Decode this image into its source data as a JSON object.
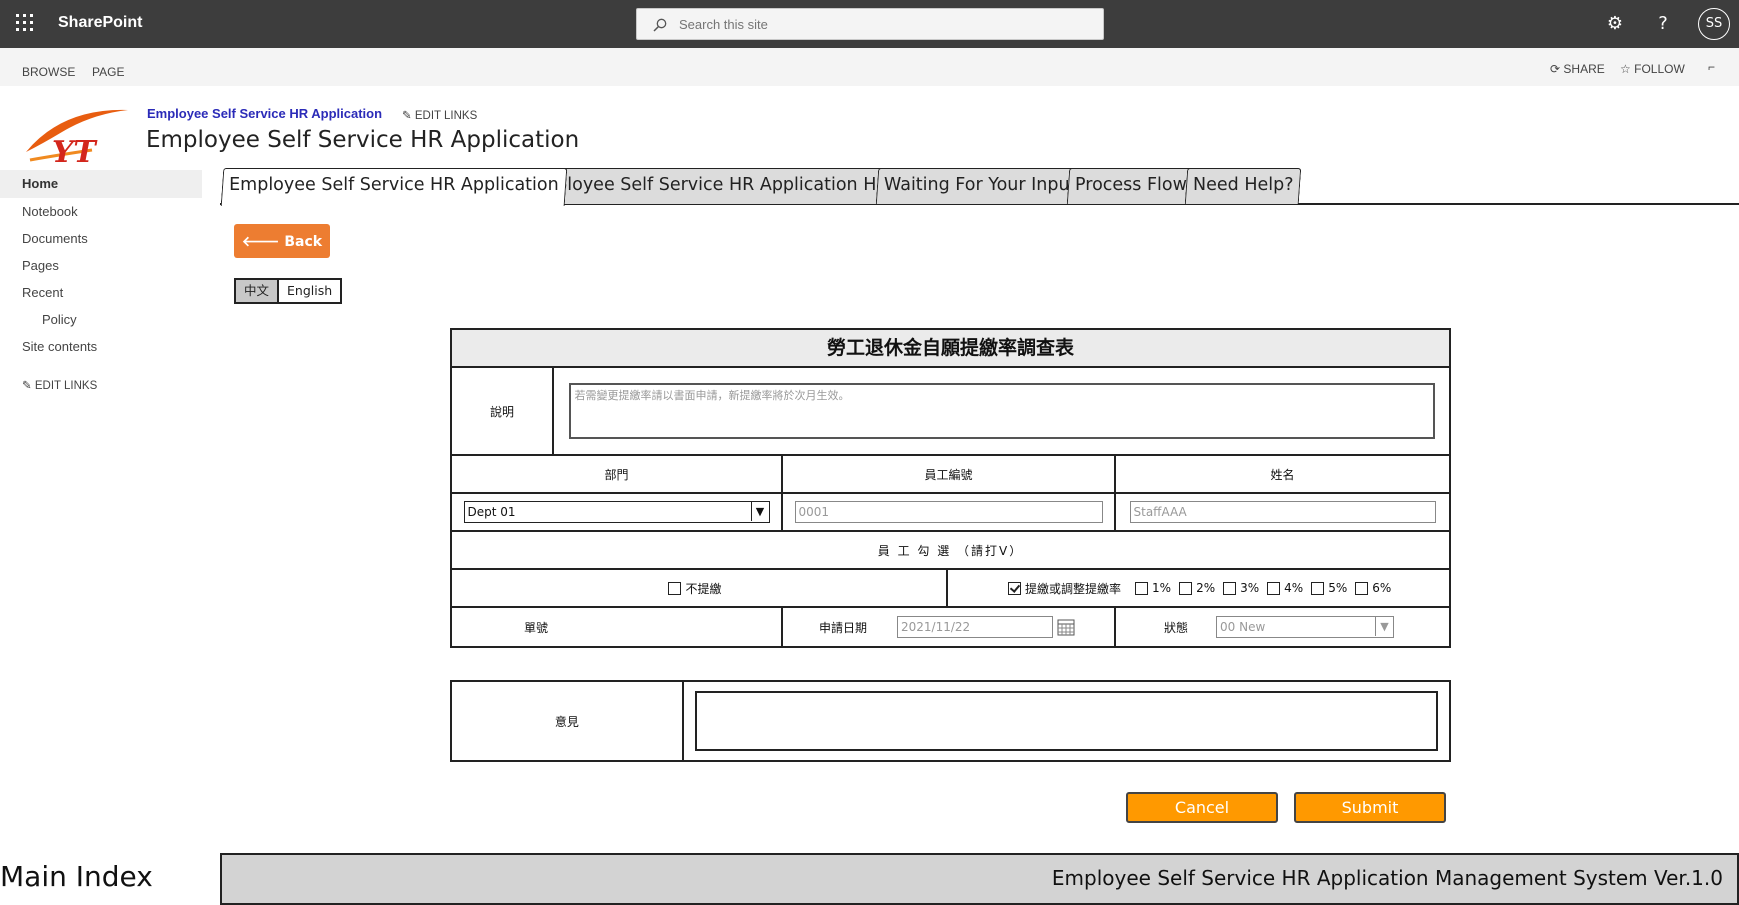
{
  "suite": {
    "brand": "SharePoint",
    "search_placeholder": "Search this site",
    "avatar_initials": "SS"
  },
  "ribbon": {
    "browse": "BROWSE",
    "page": "PAGE",
    "share": "SHARE",
    "follow": "FOLLOW"
  },
  "site": {
    "breadcrumb": "Employee Self Service HR Application",
    "edit_links": "EDIT LINKS",
    "title": "Employee Self Service HR Application"
  },
  "nav": {
    "items": [
      "Home",
      "Notebook",
      "Documents",
      "Pages",
      "Recent",
      "Policy",
      "Site contents"
    ],
    "edit_links": "EDIT LINKS"
  },
  "tabs": [
    "Employee Self Service HR Application",
    "Employee Self Service HR Application History",
    "Waiting For Your Input",
    "Process Flow",
    "Need Help?"
  ],
  "back_label": "Back",
  "language": {
    "zh": "中文",
    "en": "English"
  },
  "form": {
    "title": "勞工退休金自願提繳率調查表",
    "note_label": "說明",
    "note_text": "若需變更提繳率請以書面申請，新提繳率將於次月生效。",
    "dept_header": "部門",
    "emp_no_header": "員工編號",
    "name_header": "姓名",
    "dept_value": "Dept 01",
    "emp_no_value": "0001",
    "name_value": "StaffAAA",
    "check_title": "員 工 勾 選 （請打V）",
    "no_contribute": "不提繳",
    "adjust_label": "提繳或調整提繳率",
    "rates": [
      "1%",
      "2%",
      "3%",
      "4%",
      "5%",
      "6%"
    ],
    "form_no_label": "單號",
    "apply_date_label": "申請日期",
    "apply_date_value": "2021/11/22",
    "status_label": "狀態",
    "status_value": "00 New"
  },
  "opinion_label": "意見",
  "buttons": {
    "cancel": "Cancel",
    "submit": "Submit"
  },
  "footer": {
    "left": "Main Index",
    "right": "Employee Self Service HR Application Management System Ver.1.0"
  },
  "colors": {
    "suitebar": "#3d3d3d",
    "accent_orange": "#ed7d31",
    "button_orange": "#ff9900",
    "breadcrumb_link": "#2b2bb8"
  }
}
